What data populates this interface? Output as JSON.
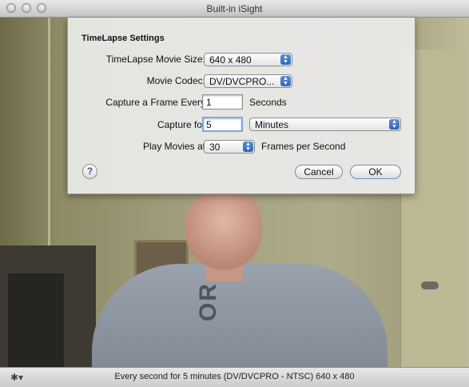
{
  "window": {
    "title": "Built-in iSight"
  },
  "shirt_text": "OR.",
  "sheet": {
    "heading": "TimeLapse Settings",
    "movie_size": {
      "label": "TimeLapse Movie Size:",
      "value": "640 x 480"
    },
    "movie_codec": {
      "label": "Movie Codec:",
      "value": "DV/DVCPRO..."
    },
    "capture_every": {
      "label": "Capture a Frame Every",
      "value": "1",
      "unit": "Seconds"
    },
    "capture_for": {
      "label": "Capture for",
      "value": "5",
      "unit": "Minutes"
    },
    "play_movies": {
      "label": "Play Movies at",
      "value": "30",
      "unit": "Frames per Second"
    },
    "help": "?",
    "cancel_label": "Cancel",
    "ok_label": "OK"
  },
  "statusbar": {
    "gear": "✱▾",
    "text": "Every second for 5 minutes (DV/DVCPRO - NTSC) 640 x 480"
  }
}
